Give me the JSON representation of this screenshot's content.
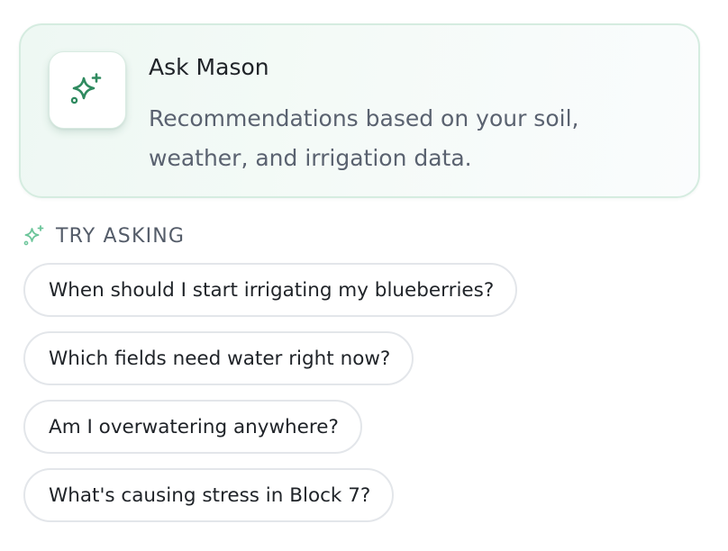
{
  "colors": {
    "accent_green": "#2f8a5f",
    "accent_green_light": "#6cc59a",
    "card_border": "#d5ece0",
    "chip_border": "#e3e6ea",
    "body_text": "#1f2328",
    "muted_text": "#5a6270"
  },
  "assistant_card": {
    "icon": "sparkles-icon",
    "title": "Ask Mason",
    "description": "Recommendations based on your soil, weather, and irrigation data."
  },
  "suggestions": {
    "icon": "sparkles-icon",
    "label": "TRY ASKING",
    "items": [
      {
        "label": "When should I start irrigating my blueberries?"
      },
      {
        "label": "Which fields need water right now?"
      },
      {
        "label": "Am I overwatering anywhere?"
      },
      {
        "label": "What's causing stress in Block 7?"
      }
    ]
  }
}
